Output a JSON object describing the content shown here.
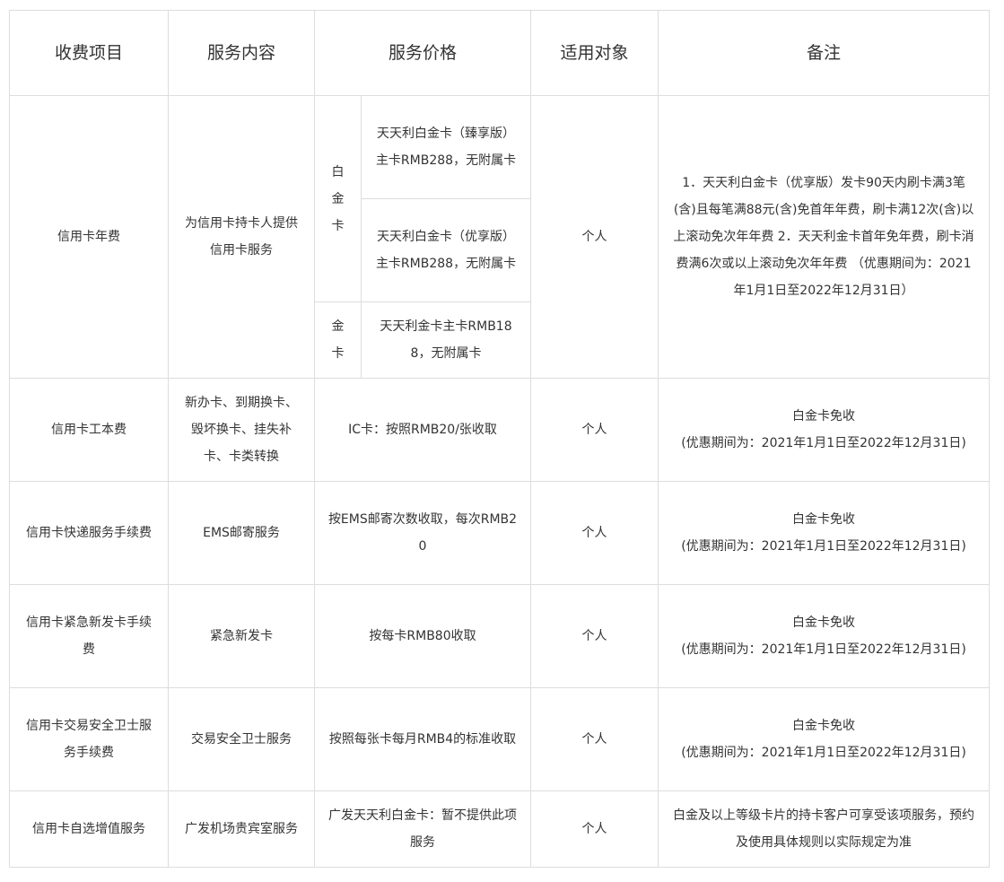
{
  "headers": [
    "收费项目",
    "服务内容",
    "服务价格",
    "适用对象",
    "备注"
  ],
  "annual": {
    "item": "信用卡年费",
    "content": "为信用卡持卡人提供信用卡服务",
    "platinum_label": "白金卡",
    "gold_label": "金卡",
    "price_platinum_1": "天天利白金卡（臻享版）主卡RMB288，无附属卡",
    "price_platinum_2": "天天利白金卡（优享版）主卡RMB288，无附属卡",
    "price_gold": "天天利金卡主卡RMB188，无附属卡",
    "target": "个人",
    "note": "1．天天利白金卡（优享版）发卡90天内刷卡满3笔(含)且每笔满88元(含)免首年年费，刷卡满12次(含)以上滚动免次年年费 2．天天利金卡首年免年费，刷卡消费满6次或以上滚动免次年年费 （优惠期间为：2021年1月1日至2022年12月31日）"
  },
  "rows": [
    {
      "item": "信用卡工本费",
      "content": "新办卡、到期换卡、毁坏换卡、挂失补卡、卡类转换",
      "price": "IC卡：按照RMB20/张收取",
      "target": "个人",
      "note_1": "白金卡免收",
      "note_2": "(优惠期间为：2021年1月1日至2022年12月31日)"
    },
    {
      "item": "信用卡快递服务手续费",
      "content": "EMS邮寄服务",
      "price": "按EMS邮寄次数收取，每次RMB20",
      "target": "个人",
      "note_1": "白金卡免收",
      "note_2": "(优惠期间为：2021年1月1日至2022年12月31日)"
    },
    {
      "item": "信用卡紧急新发卡手续费",
      "content": "紧急新发卡",
      "price": "按每卡RMB80收取",
      "target": "个人",
      "note_1": "白金卡免收",
      "note_2": "(优惠期间为：2021年1月1日至2022年12月31日)"
    },
    {
      "item": "信用卡交易安全卫士服务手续费",
      "content": "交易安全卫士服务",
      "price": "按照每张卡每月RMB4的标准收取",
      "target": "个人",
      "note_1": "白金卡免收",
      "note_2": "(优惠期间为：2021年1月1日至2022年12月31日)"
    },
    {
      "item": "信用卡自选增值服务",
      "content": "广发机场贵宾室服务",
      "price": "广发天天利白金卡：暂不提供此项服务",
      "target": "个人",
      "note_1": "白金及以上等级卡片的持卡客户可享受该项服务，预约及使用具体规则以实际规定为准",
      "note_2": ""
    }
  ]
}
